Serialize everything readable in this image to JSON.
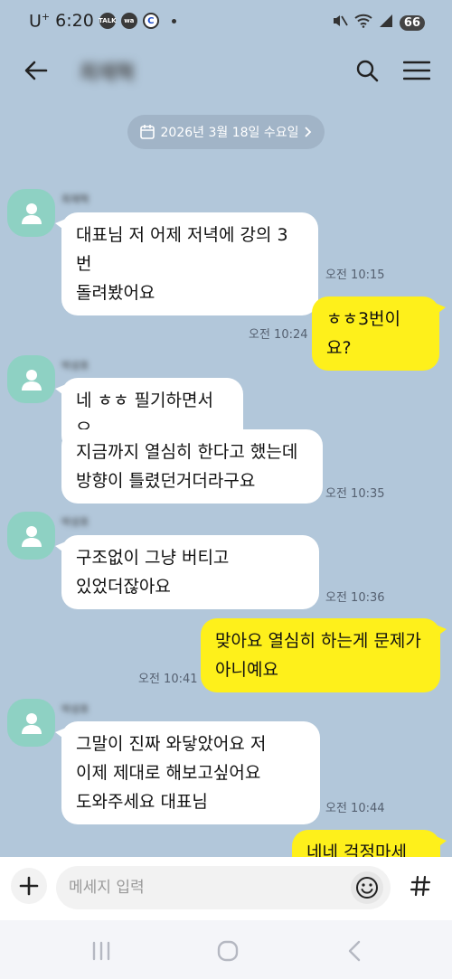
{
  "status_bar": {
    "carrier": "U",
    "carrier_sup": "+",
    "time": "6:20",
    "badges": [
      "TALK",
      "wa",
      "C"
    ],
    "battery": "66"
  },
  "header": {
    "chat_title": "최재혁"
  },
  "date_divider": "2026년 3월 18일 수요일",
  "messages": [
    {
      "dir": "in",
      "sender": "최재혁",
      "text": "대표님 저 어제 저녁에 강의 3번\n돌려봤어요",
      "time": "오전 10:15"
    },
    {
      "dir": "out",
      "text": "ㅎㅎ3번이요?",
      "time": "오전 10:24"
    },
    {
      "dir": "in",
      "sender": "박성호",
      "text": "네 ㅎㅎ 필기하면서요"
    },
    {
      "dir": "in",
      "text": "지금까지 열심히 한다고 했는데\n방향이 틀렸던거더라구요",
      "time": "오전 10:35"
    },
    {
      "dir": "in",
      "sender": "박성호",
      "text": "구조없이 그냥 버티고\n있었더잖아요",
      "time": "오전 10:36"
    },
    {
      "dir": "out",
      "text": "맞아요 열심히 하는게 문제가\n아니예요",
      "time": "오전 10:41"
    },
    {
      "dir": "in",
      "sender": "박성호",
      "text": "그말이 진짜 와닿았어요 저\n이제 제대로 해보고싶어요\n도와주세요 대표님",
      "time": "오전 10:44"
    },
    {
      "dir": "out",
      "text": "네네 걱정마세요!"
    }
  ],
  "input": {
    "placeholder": "메세지 입력",
    "value": ""
  },
  "icons": {
    "back": "arrow-left-icon",
    "search": "search-icon",
    "menu": "hamburger-menu-icon",
    "calendar": "calendar-icon",
    "plus": "plus-icon",
    "emoji": "smiley-icon",
    "hash": "hash-icon",
    "avatar": "person-icon"
  },
  "colors": {
    "chat_background": "#b2c7da",
    "incoming_bubble": "#ffffff",
    "outgoing_bubble": "#fef01b",
    "avatar": "#8ed1c3",
    "date_pill": "#a1b4c7"
  }
}
